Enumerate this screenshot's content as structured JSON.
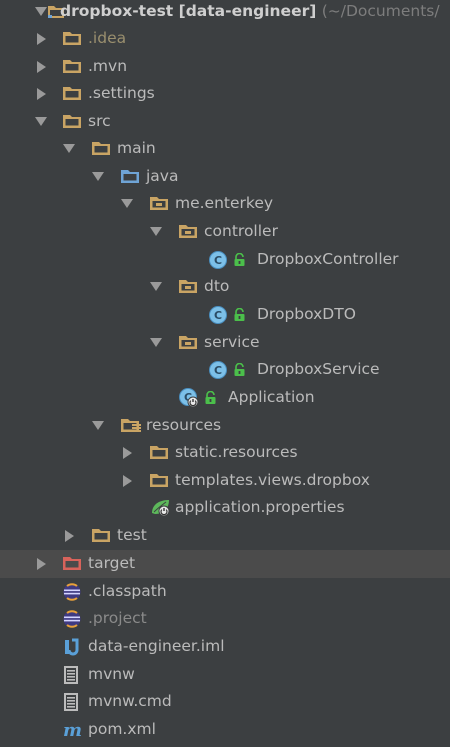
{
  "project": {
    "name": "dropbox-test",
    "module": "[data-engineer]",
    "path": "(~/Documents/"
  },
  "tree": {
    "idea": ".idea",
    "mvn": ".mvn",
    "settings": ".settings",
    "src": "src",
    "main": "main",
    "java": "java",
    "package": "me.enterkey",
    "controller": "controller",
    "controller_class": "DropboxController",
    "dto": "dto",
    "dto_class": "DropboxDTO",
    "service": "service",
    "service_class": "DropboxService",
    "application": "Application",
    "resources": "resources",
    "static_resources": "static.resources",
    "templates": "templates.views.dropbox",
    "app_properties": "application.properties",
    "test": "test",
    "target": "target",
    "classpath": ".classpath",
    "project_file": ".project",
    "iml": "data-engineer.iml",
    "mvnw": "mvnw",
    "mvnw_cmd": "mvnw.cmd",
    "pom": "pom.xml"
  },
  "colors": {
    "background": "#3c3f41",
    "selected_row": "#4b4b4b",
    "folder": "#c9a464",
    "source_folder": "#6fa4d6",
    "excluded_folder": "#d8635b",
    "class_badge": "#7cc0e8",
    "lock": "#4bbf4b"
  },
  "icons": {
    "folder": "folder-icon",
    "source_root": "source-root-folder-icon",
    "package": "package-icon",
    "class": "class-icon",
    "lock": "lock-icon",
    "spring": "spring-boot-icon",
    "eclipse": "eclipse-icon",
    "file": "text-file-icon",
    "maven": "maven-icon"
  }
}
